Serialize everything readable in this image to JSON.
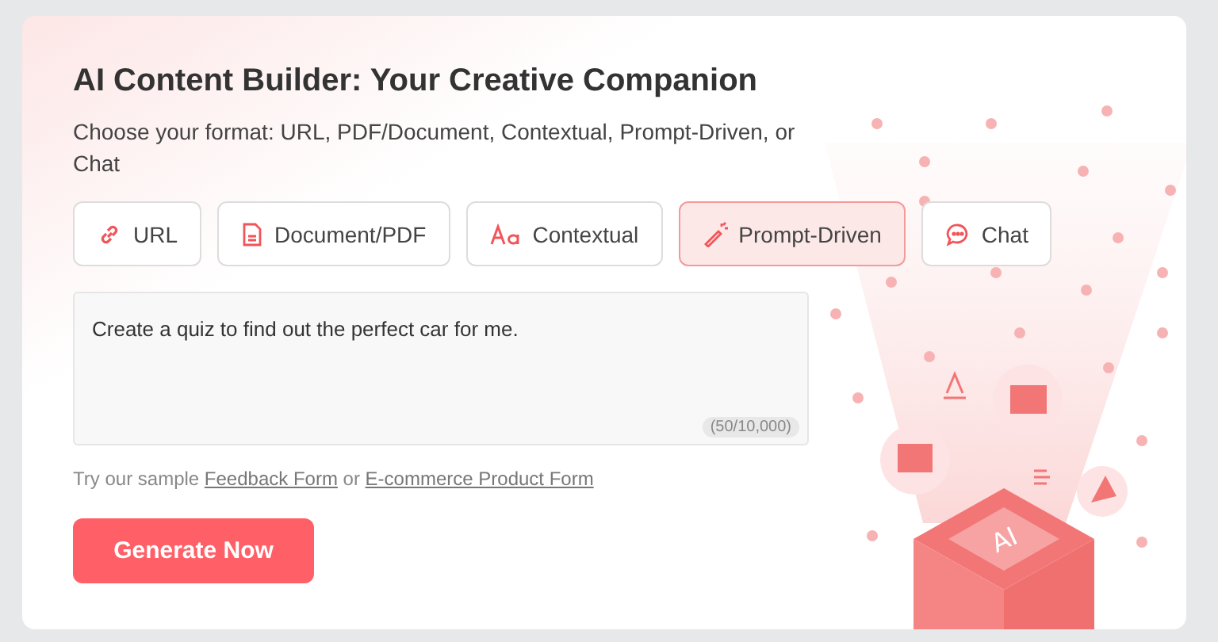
{
  "title": "AI Content Builder: Your Creative Companion",
  "subtitle": "Choose your format: URL, PDF/Document, Contextual, Prompt-Driven, or Chat",
  "tabs": [
    {
      "label": "URL",
      "kind": "link",
      "selected": false
    },
    {
      "label": "Document/PDF",
      "kind": "document",
      "selected": false
    },
    {
      "label": "Contextual",
      "kind": "text",
      "selected": false
    },
    {
      "label": "Prompt-Driven",
      "kind": "wand",
      "selected": true
    },
    {
      "label": "Chat",
      "kind": "chat",
      "selected": false
    }
  ],
  "prompt": {
    "value": "Create a quiz to find out the perfect car for me.",
    "counter": "(50/10,000)"
  },
  "samples": {
    "prefix": "Try our sample",
    "links": [
      "Feedback Form",
      "E-commerce Product Form"
    ],
    "joiner": "or"
  },
  "generate_button": "Generate Now",
  "illustration": {
    "label": "AI"
  }
}
